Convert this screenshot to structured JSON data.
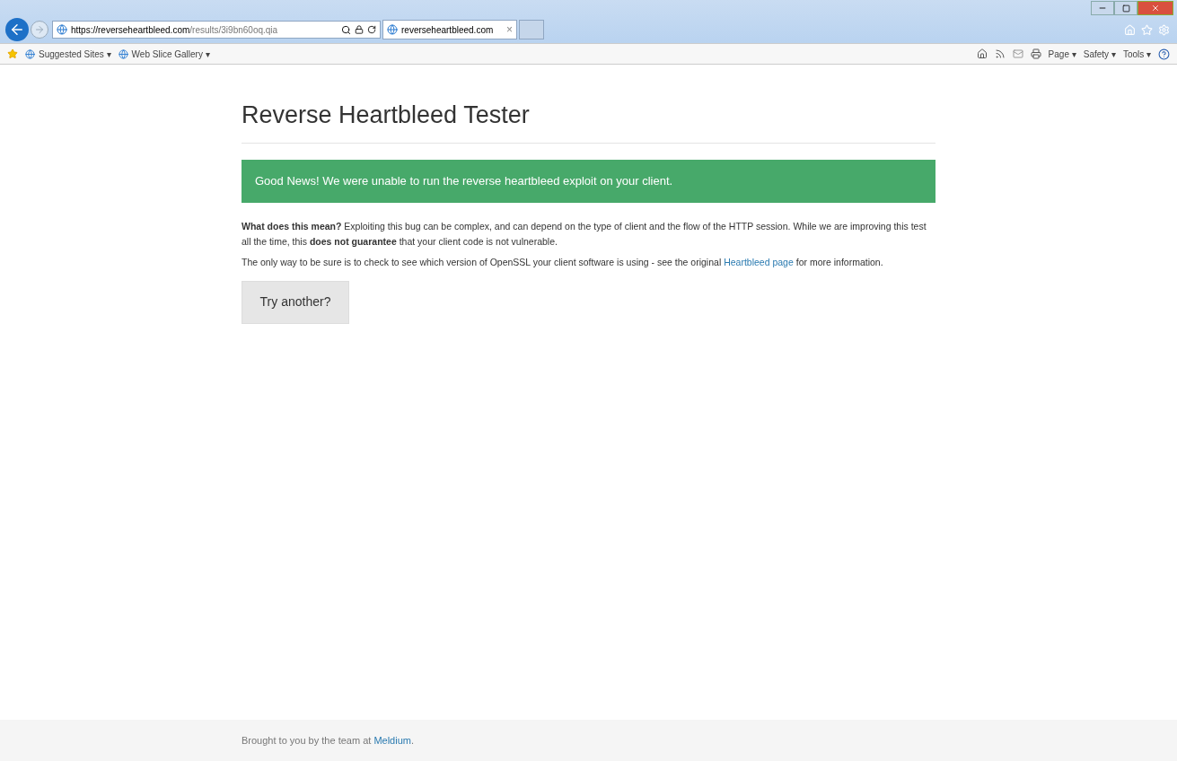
{
  "browser": {
    "address": {
      "host": "https://reverseheartbleed.com",
      "path": "/results/3i9bn60oq.qia"
    },
    "tab": {
      "title": "reverseheartbleed.com",
      "close": "×"
    },
    "favorites": [
      {
        "label": "Suggested Sites ▾"
      },
      {
        "label": "Web Slice Gallery ▾"
      }
    ],
    "commands": [
      {
        "label": "Page ▾"
      },
      {
        "label": "Safety ▾"
      },
      {
        "label": "Tools ▾"
      }
    ]
  },
  "page": {
    "title": "Reverse Heartbleed Tester",
    "alert": "Good News! We were unable to run the reverse heartbleed exploit on your client.",
    "explanation": "**What does this mean?** Exploiting this bug can be complex, and can depend on the type of client and the flow of the HTTP session. While we are improving this test all the time, this **does not guarantee** that your client code is not vulnerable.",
    "advice": {
      "before": "The only way to be sure is to check to see which version of OpenSSL your client software is using - see the original ",
      "link": "Heartbleed page",
      "after": " for more information."
    },
    "button": "Try another?"
  },
  "footer": {
    "before": "Brought to you by the team at ",
    "link": "Meldium",
    "after": "."
  }
}
